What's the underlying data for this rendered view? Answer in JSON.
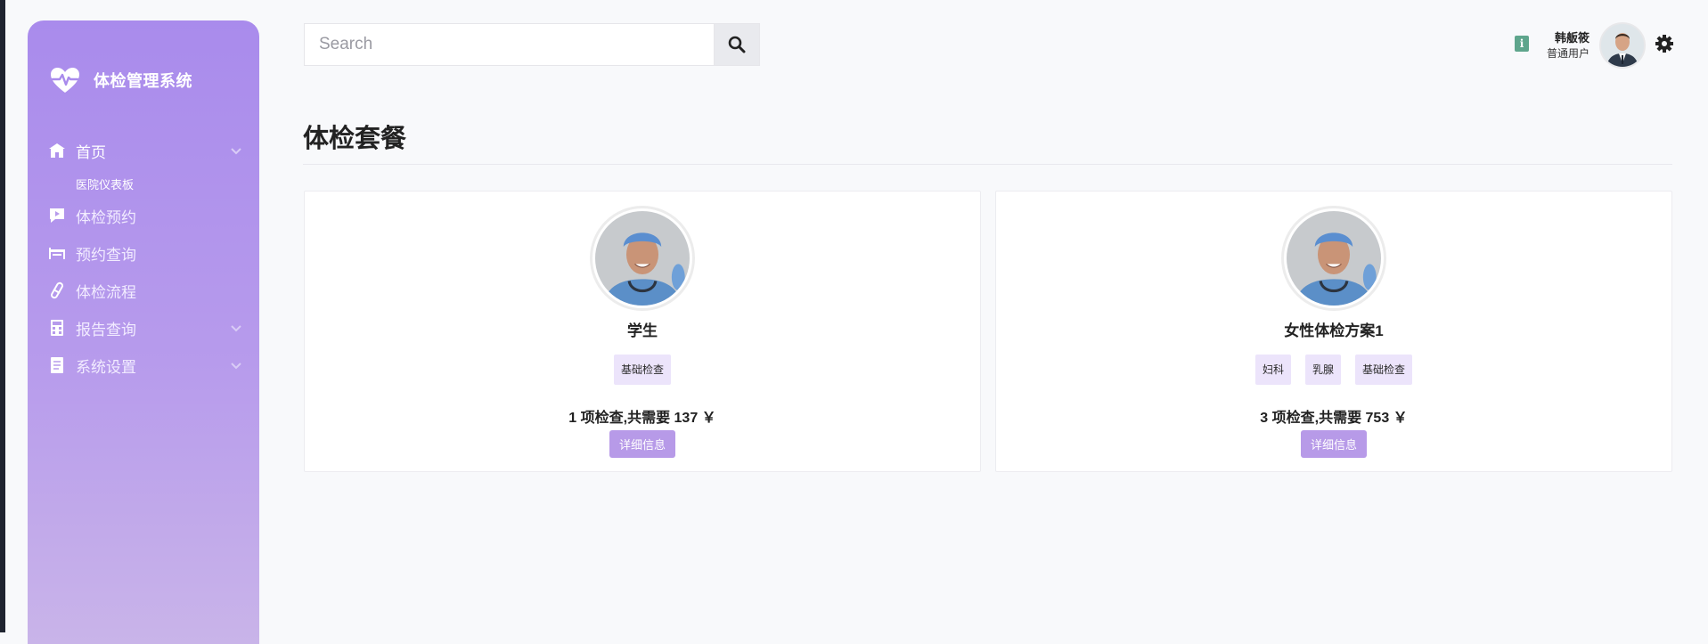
{
  "brand": {
    "title": "体检管理系统"
  },
  "sidebar": {
    "items": [
      {
        "label": "首页",
        "icon": "home-icon",
        "has_chevron": true
      },
      {
        "label": "体检预约",
        "icon": "video-chat-icon",
        "has_chevron": false
      },
      {
        "label": "预约查询",
        "icon": "bed-icon",
        "has_chevron": false
      },
      {
        "label": "体检流程",
        "icon": "pill-icon",
        "has_chevron": false
      },
      {
        "label": "报告查询",
        "icon": "calculator-icon",
        "has_chevron": true
      },
      {
        "label": "系统设置",
        "icon": "document-icon",
        "has_chevron": true
      }
    ],
    "sub_items": [
      {
        "label": "医院仪表板"
      }
    ]
  },
  "search": {
    "placeholder": "Search",
    "value": ""
  },
  "user": {
    "name": "韩舨筱",
    "role": "普通用户",
    "info_badge": "i"
  },
  "page": {
    "title": "体检套餐"
  },
  "packages": [
    {
      "name": "学生",
      "tags": [
        "基础检查"
      ],
      "summary": "1 项检查,共需要 137 ￥",
      "detail_label": "详细信息"
    },
    {
      "name": "女性体检方案1",
      "tags": [
        "妇科",
        "乳腺",
        "基础检查"
      ],
      "summary": "3 项检查,共需要 753 ￥",
      "detail_label": "详细信息"
    }
  ],
  "colors": {
    "sidebar_top": "#a98bec",
    "sidebar_bottom": "#c9b4e9",
    "tag_bg": "#ece4fb",
    "button_bg": "#b79ae8",
    "info_badge": "#5ea58c"
  }
}
